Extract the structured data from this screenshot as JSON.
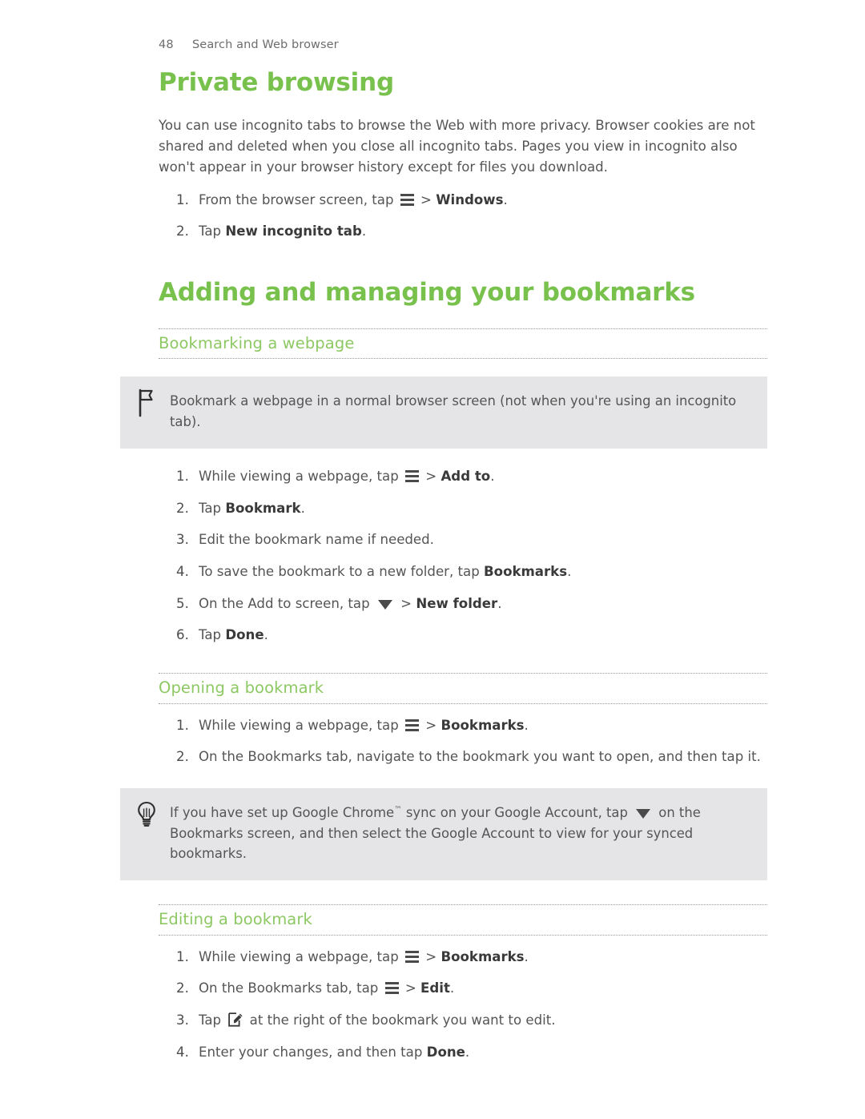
{
  "header": {
    "page_number": "48",
    "section_title": "Search and Web browser"
  },
  "sections": [
    {
      "id": "private-browsing",
      "heading": "Private browsing",
      "paragraph": "You can use incognito tabs to browse the Web with more privacy. Browser cookies are not shared and deleted when you close all incognito tabs. Pages you view in incognito also won't appear in your browser history except for files you download.",
      "steps": [
        {
          "pre": "From the browser screen, tap ",
          "icon": "menu-icon",
          "mid": " > ",
          "bold": "Windows",
          "post": "."
        },
        {
          "pre": "Tap ",
          "icon": "",
          "mid": "",
          "bold": "New incognito tab",
          "post": "."
        }
      ]
    }
  ],
  "bookmarks": {
    "heading": "Adding and managing your bookmarks",
    "subsections": [
      {
        "id": "bookmarking-a-webpage",
        "subheading": "Bookmarking a webpage",
        "note": {
          "icon": "flag-icon",
          "text": "Bookmark a webpage in a normal browser screen (not when you're using an incognito tab)."
        },
        "steps": [
          {
            "pre": "While viewing a webpage, tap ",
            "icon": "menu-icon",
            "mid": " > ",
            "bold": "Add to",
            "post": "."
          },
          {
            "pre": "Tap ",
            "icon": "",
            "mid": "",
            "bold": "Bookmark",
            "post": "."
          },
          {
            "pre": "Edit the bookmark name if needed.",
            "icon": "",
            "mid": "",
            "bold": "",
            "post": ""
          },
          {
            "pre": "To save the bookmark to a new folder, tap ",
            "icon": "",
            "mid": "",
            "bold": "Bookmarks",
            "post": "."
          },
          {
            "pre": "On the Add to screen, tap ",
            "icon": "caret-down-icon",
            "mid": " > ",
            "bold": "New folder",
            "post": "."
          },
          {
            "pre": "Tap ",
            "icon": "",
            "mid": "",
            "bold": "Done",
            "post": "."
          }
        ]
      },
      {
        "id": "opening-a-bookmark",
        "subheading": "Opening a bookmark",
        "steps": [
          {
            "pre": "While viewing a webpage, tap ",
            "icon": "menu-icon",
            "mid": " > ",
            "bold": "Bookmarks",
            "post": "."
          },
          {
            "pre": "On the Bookmarks tab, navigate to the bookmark you want to open, and then tap it.",
            "icon": "",
            "mid": "",
            "bold": "",
            "post": ""
          }
        ],
        "tip": {
          "icon": "lightbulb-icon",
          "text_before": "If you have set up Google Chrome",
          "trademark": "™",
          "text_mid": " sync on your Google Account, tap ",
          "inline_icon": "caret-down-icon",
          "text_after": " on the Bookmarks screen, and then select the Google Account to view for your synced bookmarks."
        }
      },
      {
        "id": "editing-a-bookmark",
        "subheading": "Editing a bookmark",
        "steps": [
          {
            "pre": "While viewing a webpage, tap ",
            "icon": "menu-icon",
            "mid": " > ",
            "bold": "Bookmarks",
            "post": "."
          },
          {
            "pre": "On the Bookmarks tab, tap ",
            "icon": "menu-icon",
            "mid": " > ",
            "bold": "Edit",
            "post": "."
          },
          {
            "pre": "Tap ",
            "icon": "edit-icon",
            "mid": " at the right of the bookmark you want to edit.",
            "bold": "",
            "post": ""
          },
          {
            "pre": "Enter your changes, and then tap ",
            "icon": "",
            "mid": "",
            "bold": "Done",
            "post": "."
          }
        ]
      }
    ]
  },
  "colors": {
    "heading_green": "#79c14d",
    "subheading_green": "#8dc863",
    "body_text": "#555555",
    "callout_bg": "#e5e5e7",
    "rule_dotted": "#9a9a9a"
  }
}
